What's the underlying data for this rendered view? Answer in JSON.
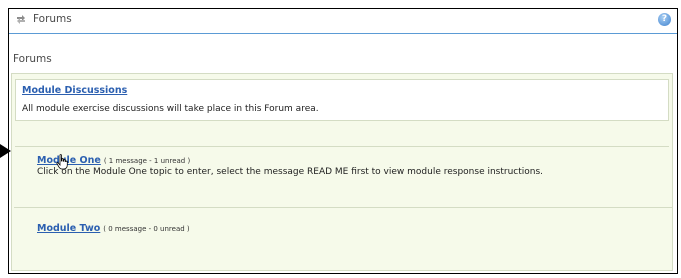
{
  "header": {
    "title": "Forums",
    "title_icon": "forum-icon",
    "help_icon": "help-icon"
  },
  "section": {
    "title": "Forums"
  },
  "discussions": {
    "link": "Module Discussions",
    "description": "All module exercise discussions will take place in this Forum area."
  },
  "topics": [
    {
      "link": "Module One",
      "meta": "( 1 message - 1 unread )",
      "description": "Click on the Module One topic to enter, select the message READ ME first to view module response instructions."
    },
    {
      "link": "Module Two",
      "meta": "( 0 message - 0 unread )"
    }
  ],
  "colors": {
    "link": "#2b5fb0",
    "panel_bg": "#f6faea",
    "border": "#d4dcc4",
    "title_underline": "#5b9bd5"
  }
}
